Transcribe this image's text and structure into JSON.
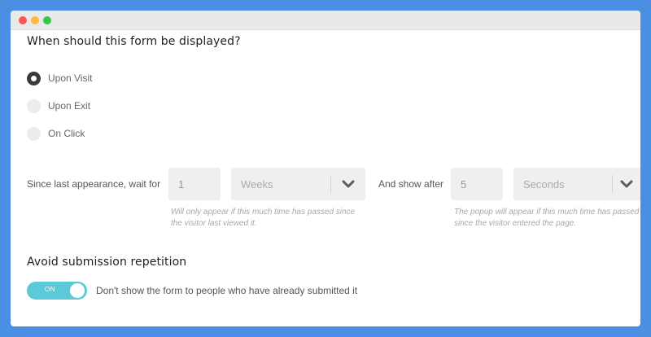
{
  "display": {
    "heading": "When should this form be displayed?",
    "options": [
      {
        "label": "Upon Visit",
        "selected": true
      },
      {
        "label": "Upon Exit",
        "selected": false
      },
      {
        "label": "On Click",
        "selected": false
      }
    ]
  },
  "wait": {
    "label": "Since last appearance, wait for",
    "value": "1",
    "unit": "Weeks",
    "hint_line1": "Will only appear if this much time has passed since",
    "hint_line2": "the visitor last viewed it."
  },
  "delay": {
    "label": "And show after",
    "value": "5",
    "unit": "Seconds",
    "hint_line1": "The popup will appear if this much time has passed",
    "hint_line2": "since the visitor entered the page."
  },
  "repetition": {
    "heading": "Avoid submission repetition",
    "toggle_state": "ON",
    "description": "Don't show the form to people who have already submitted it"
  },
  "colors": {
    "background": "#4a90e2",
    "toggle_on": "#5bc9d8",
    "radio_selected": "#3a3a3a"
  }
}
